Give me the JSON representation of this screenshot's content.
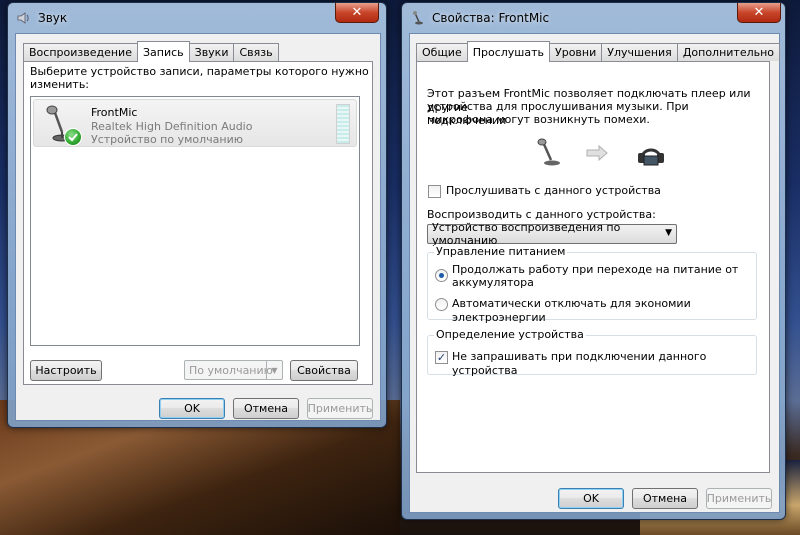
{
  "sound_window": {
    "title": "Звук",
    "tabs": [
      {
        "label": "Воспроизведение"
      },
      {
        "label": "Запись",
        "active": true
      },
      {
        "label": "Звуки"
      },
      {
        "label": "Связь"
      }
    ],
    "instruction": "Выберите устройство записи, параметры которого нужно изменить:",
    "instruction_line1": "Выберите устройство записи, параметры которого нужно",
    "instruction_line2": "изменить:",
    "device": {
      "name": "FrontMic",
      "driver": "Realtek High Definition Audio",
      "status": "Устройство по умолчанию",
      "icon": "microphone-icon",
      "badge_icon": "green-check-icon"
    },
    "buttons": {
      "configure": "Настроить",
      "default": "По умолчанию",
      "properties": "Свойства",
      "ok": "OK",
      "cancel": "Отмена",
      "apply": "Применить"
    }
  },
  "props_window": {
    "title": "Свойства: FrontMic",
    "tabs": [
      {
        "label": "Общие"
      },
      {
        "label": "Прослушать",
        "active": true
      },
      {
        "label": "Уровни"
      },
      {
        "label": "Улучшения"
      },
      {
        "label": "Дополнительно"
      }
    ],
    "description_line1": "Этот разъем FrontMic позволяет подключать плеер или другие",
    "description_line2": "устройства для прослушивания музыки. При подключении",
    "description_line3": "микрофона могут возникнуть помехи.",
    "listen_checkbox": {
      "label": "Прослушивать с данного устройства",
      "checked": false
    },
    "playback_label": "Воспроизводить с данного устройства:",
    "playback_select_value": "Устройство воспроизведения по умолчанию",
    "power_group": {
      "title": "Управление питанием",
      "option1_line1": "Продолжать работу при переходе на питание от",
      "option1_line2": "аккумулятора",
      "option1_checked": true,
      "option2": "Автоматически отключать для экономии электроэнергии",
      "option2_checked": false
    },
    "detect_group": {
      "title": "Определение устройства",
      "checkbox_label": "Не запрашивать при подключении данного устройства",
      "checked": true
    },
    "buttons": {
      "ok": "OK",
      "cancel": "Отмена",
      "apply": "Применить"
    }
  },
  "colors": {
    "close_button": "#c8452a",
    "accent_blue": "#1d5aa8",
    "check_green": "#2fa82f"
  }
}
